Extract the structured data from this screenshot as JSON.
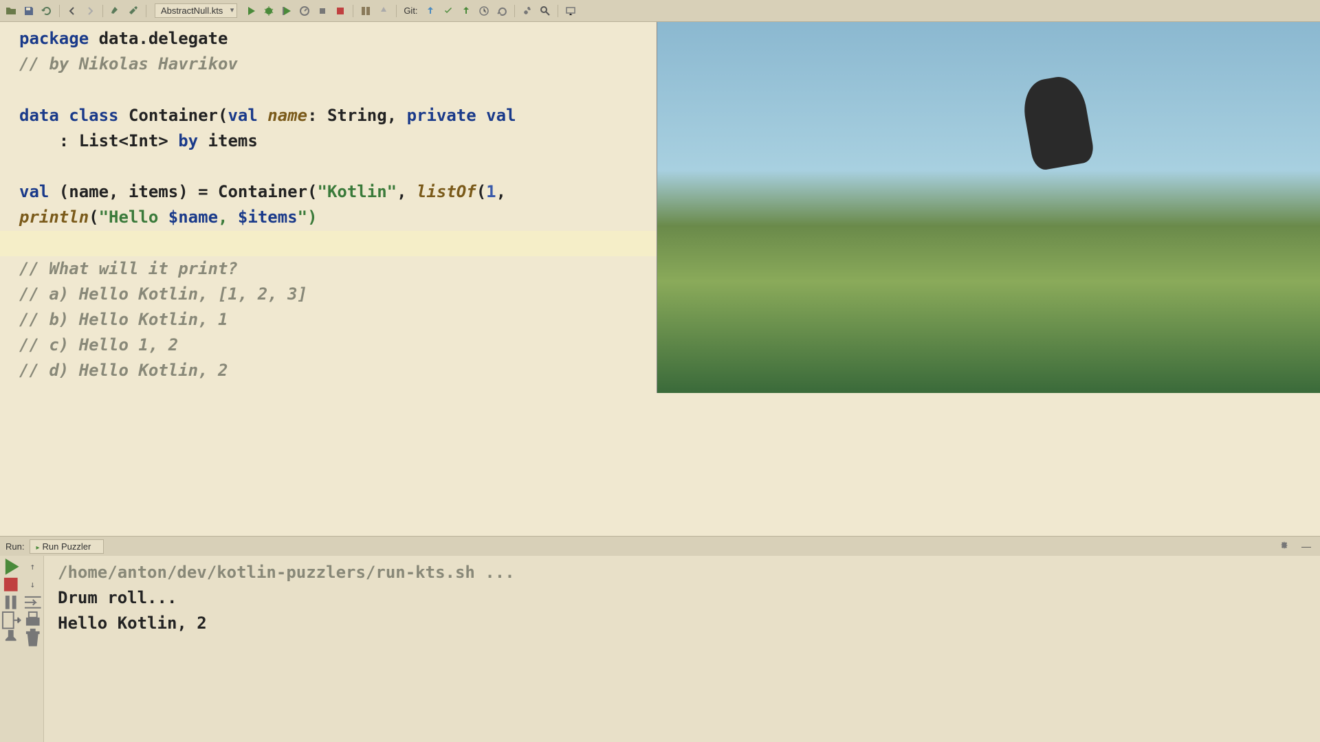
{
  "toolbar": {
    "file_dropdown": "AbstractNull.kts",
    "git_label": "Git:"
  },
  "code": {
    "l1_package": "package",
    "l1_pkg": " data.delegate",
    "l2": "// by Nikolas Havrikov",
    "l3_data": "data",
    "l3_class": "class",
    "l3_container": " Container(",
    "l3_val": "val",
    "l3_name": " name",
    "l3_string": ": String, ",
    "l3_private": "private",
    "l3_val2": " val",
    "l4_listint": "    : List<Int> ",
    "l4_by": "by",
    "l4_items": " items",
    "l5_val": "val",
    "l5_destr": " (name, items) = Container(",
    "l5_str": "\"Kotlin\"",
    "l5_comma": ", ",
    "l5_listof": "listOf",
    "l5_paren": "(",
    "l5_num": "1",
    "l5_end": ",",
    "l6_println": "println",
    "l6_open": "(",
    "l6_hello": "\"Hello ",
    "l6_dname": "$name",
    "l6_comma": ", ",
    "l6_ditems": "$items",
    "l6_close": "\")",
    "l7": "// What will it print?",
    "l8": "// a) Hello Kotlin, [1, 2, 3]",
    "l9": "// b) Hello Kotlin, 1",
    "l10": "// c) Hello 1, 2",
    "l11": "// d) Hello Kotlin, 2"
  },
  "run": {
    "label": "Run:",
    "tab": "Run Puzzler",
    "out_cmd": "/home/anton/dev/kotlin-puzzlers/run-kts.sh ...",
    "out_l1": "Drum roll...",
    "out_l2": "Hello Kotlin, 2"
  }
}
